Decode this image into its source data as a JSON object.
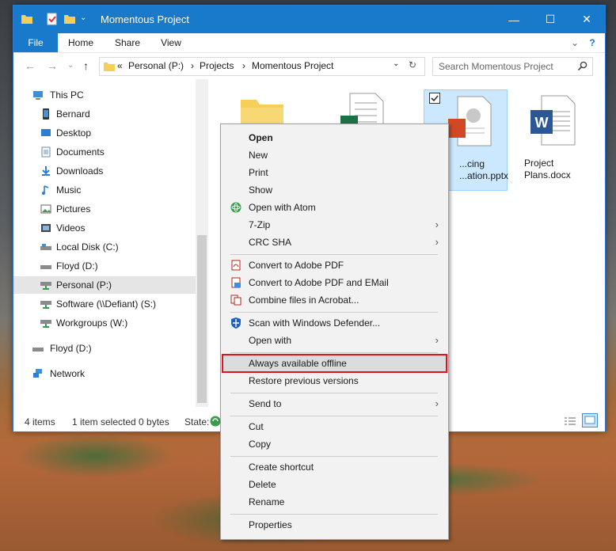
{
  "window": {
    "title": "Momentous Project",
    "tabs": [
      "File",
      "Home",
      "Share",
      "View"
    ],
    "controls": {
      "minimize": "—",
      "maximize": "☐",
      "close": "✕",
      "expand": "⌄",
      "help": "?"
    }
  },
  "address": {
    "back": "←",
    "forward": "→",
    "recent": "⌄",
    "up": "↑",
    "overflow": "«",
    "segments": [
      "Personal (P:)",
      "Projects",
      "Momentous Project"
    ],
    "separator": "›",
    "dropdown": "⌄",
    "refresh": "↻",
    "search_placeholder": "Search Momentous Project"
  },
  "sidebar": {
    "items": [
      {
        "label": "This PC",
        "icon": "pc-icon",
        "indent": 0
      },
      {
        "label": "Bernard",
        "icon": "phone-icon",
        "indent": 1
      },
      {
        "label": "Desktop",
        "icon": "desktop-icon",
        "indent": 1
      },
      {
        "label": "Documents",
        "icon": "documents-icon",
        "indent": 1
      },
      {
        "label": "Downloads",
        "icon": "downloads-icon",
        "indent": 1
      },
      {
        "label": "Music",
        "icon": "music-icon",
        "indent": 1
      },
      {
        "label": "Pictures",
        "icon": "pictures-icon",
        "indent": 1
      },
      {
        "label": "Videos",
        "icon": "videos-icon",
        "indent": 1
      },
      {
        "label": "Local Disk (C:)",
        "icon": "disk-icon",
        "indent": 1
      },
      {
        "label": "Floyd (D:)",
        "icon": "drive-icon",
        "indent": 1
      },
      {
        "label": "Personal (P:)",
        "icon": "network-drive-icon",
        "indent": 1,
        "selected": true
      },
      {
        "label": "Software (\\\\Defiant) (S:)",
        "icon": "network-drive-icon",
        "indent": 1
      },
      {
        "label": "Workgroups (W:)",
        "icon": "network-drive-icon",
        "indent": 1
      },
      {
        "label": "Floyd (D:)",
        "icon": "drive-icon",
        "indent": 0
      },
      {
        "label": "Network",
        "icon": "network-icon",
        "indent": 0
      }
    ]
  },
  "files": [
    {
      "name": "",
      "type": "folder"
    },
    {
      "name": "",
      "type": "xlsx"
    },
    {
      "name_line1": "...cing",
      "name_line2": "...ation.pptx",
      "type": "pptx",
      "selected": true
    },
    {
      "name_line1": "Project",
      "name_line2": "Plans.docx",
      "type": "docx"
    }
  ],
  "status": {
    "items": "4 items",
    "selected": "1 item selected  0 bytes",
    "state_label": "State:"
  },
  "context_menu": {
    "groups": [
      [
        {
          "label": "Open",
          "bold": true
        },
        {
          "label": "New"
        },
        {
          "label": "Print"
        },
        {
          "label": "Show"
        },
        {
          "label": "Open with Atom",
          "icon": "atom-icon"
        },
        {
          "label": "7-Zip",
          "submenu": true
        },
        {
          "label": "CRC SHA",
          "submenu": true
        }
      ],
      [
        {
          "label": "Convert to Adobe PDF",
          "icon": "pdf-icon"
        },
        {
          "label": "Convert to Adobe PDF and EMail",
          "icon": "pdf-email-icon"
        },
        {
          "label": "Combine files in Acrobat...",
          "icon": "acrobat-combine-icon"
        }
      ],
      [
        {
          "label": "Scan with Windows Defender...",
          "icon": "defender-shield-icon"
        },
        {
          "label": "Open with",
          "submenu": true
        }
      ],
      [
        {
          "label": "Always available offline",
          "highlight": true
        },
        {
          "label": "Restore previous versions"
        }
      ],
      [
        {
          "label": "Send to",
          "submenu": true
        }
      ],
      [
        {
          "label": "Cut"
        },
        {
          "label": "Copy"
        }
      ],
      [
        {
          "label": "Create shortcut"
        },
        {
          "label": "Delete"
        },
        {
          "label": "Rename"
        }
      ],
      [
        {
          "label": "Properties"
        }
      ]
    ],
    "submenu_arrow": "›"
  },
  "colors": {
    "titlebar": "#1979ca",
    "highlight_border": "#e0141e",
    "selection": "#cce8ff"
  }
}
